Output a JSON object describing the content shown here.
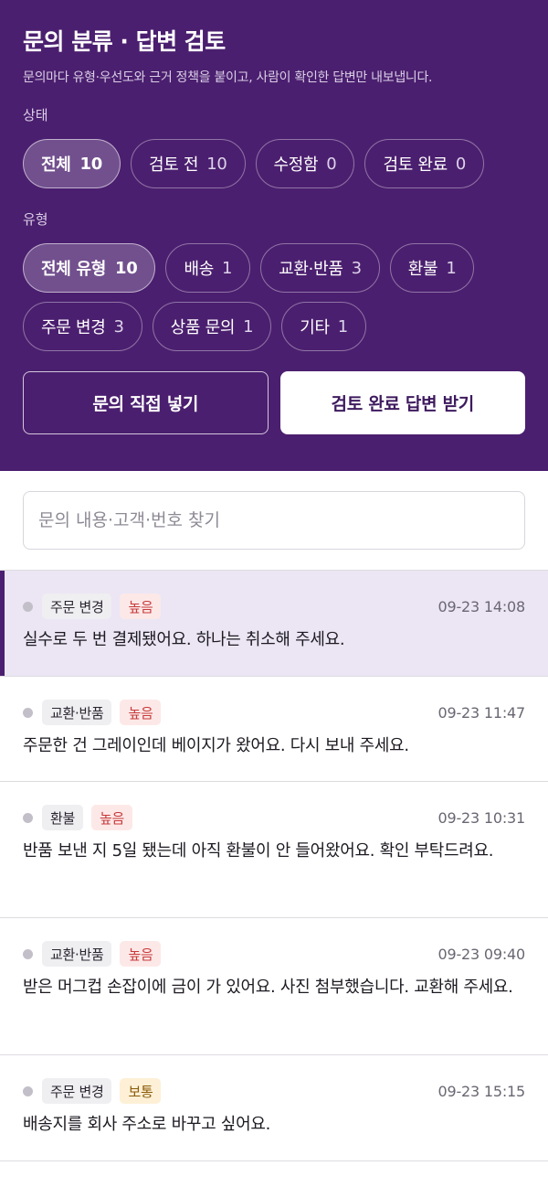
{
  "header": {
    "title": "문의 분류 · 답변 검토",
    "subtitle": "문의마다 유형·우선도와 근거 정책을 붙이고, 사람이 확인한 답변만 내보냅니다."
  },
  "status_filter": {
    "label": "상태",
    "chips": [
      {
        "label": "전체",
        "count": "10"
      },
      {
        "label": "검토 전",
        "count": "10"
      },
      {
        "label": "수정함",
        "count": "0"
      },
      {
        "label": "검토 완료",
        "count": "0"
      }
    ]
  },
  "type_filter": {
    "label": "유형",
    "chips": [
      {
        "label": "전체 유형",
        "count": "10"
      },
      {
        "label": "배송",
        "count": "1"
      },
      {
        "label": "교환·반품",
        "count": "3"
      },
      {
        "label": "환불",
        "count": "1"
      },
      {
        "label": "주문 변경",
        "count": "3"
      },
      {
        "label": "상품 문의",
        "count": "1"
      },
      {
        "label": "기타",
        "count": "1"
      }
    ]
  },
  "actions": {
    "add_inquiry": "문의 직접 넣기",
    "get_reviewed": "검토 완료 답변 받기"
  },
  "search": {
    "placeholder": "문의 내용·고객·번호 찾기"
  },
  "inquiries": [
    {
      "type": "주문 변경",
      "priority": "높음",
      "time": "09-23 14:08",
      "text": "실수로 두 번 결제됐어요. 하나는 취소해 주세요."
    },
    {
      "type": "교환·반품",
      "priority": "높음",
      "time": "09-23 11:47",
      "text": "주문한 건 그레이인데 베이지가 왔어요. 다시 보내 주세요."
    },
    {
      "type": "환불",
      "priority": "높음",
      "time": "09-23 10:31",
      "text": "반품 보낸 지 5일 됐는데 아직 환불이 안 들어왔어요. 확인 부탁드려요."
    },
    {
      "type": "교환·반품",
      "priority": "높음",
      "time": "09-23 09:40",
      "text": "받은 머그컵 손잡이에 금이 가 있어요. 사진 첨부했습니다. 교환해 주세요."
    },
    {
      "type": "주문 변경",
      "priority": "보통",
      "time": "09-23 15:15",
      "text": "배송지를 회사 주소로 바꾸고 싶어요."
    }
  ],
  "colors": {
    "header_bg": "#4b1f6f",
    "selected_bg": "#ece6f4",
    "priority_high": "#c83a3a",
    "priority_mid": "#8a5a08"
  }
}
